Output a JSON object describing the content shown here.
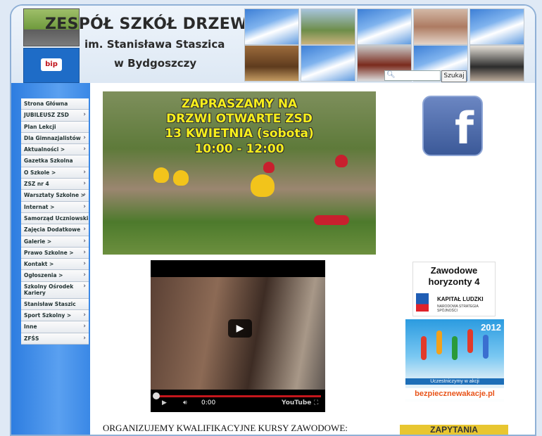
{
  "header": {
    "title_line1": "ZESPÓŁ SZKÓŁ DRZEWNYCH",
    "title_line2": "im. Stanisława Staszica",
    "title_line3": "w Bydgoszczy",
    "bip_label": "bip"
  },
  "search": {
    "placeholder": "",
    "button_label": "Szukaj"
  },
  "sidebar": {
    "items": [
      {
        "label": "Strona Główna",
        "arrow": ""
      },
      {
        "label": "JUBILEUSZ ZSD",
        "arrow": "›"
      },
      {
        "label": "Plan Lekcji",
        "arrow": ""
      },
      {
        "label": "Dla Gimnazjalistów",
        "arrow": "›"
      },
      {
        "label": "Aktualności >",
        "arrow": "›"
      },
      {
        "label": "Gazetka Szkolna",
        "arrow": ""
      },
      {
        "label": "O Szkole >",
        "arrow": "›"
      },
      {
        "label": "ZSZ nr 4",
        "arrow": "›"
      },
      {
        "label": "Warsztaty Szkolne >",
        "arrow": "›"
      },
      {
        "label": "Internat >",
        "arrow": "›"
      },
      {
        "label": "Samorząd Uczniowski",
        "arrow": ""
      },
      {
        "label": "Zajęcia Dodatkowe",
        "arrow": "›"
      },
      {
        "label": "Galerie >",
        "arrow": "›"
      },
      {
        "label": "Prawo Szkolne >",
        "arrow": "›"
      },
      {
        "label": "Kontakt >",
        "arrow": "›"
      },
      {
        "label": "Ogłoszenia >",
        "arrow": "›"
      },
      {
        "label": "Szkolny Ośrodek Kariery",
        "arrow": "›"
      },
      {
        "label": "Stanisław Staszic",
        "arrow": ""
      },
      {
        "label": "Sport Szkolny >",
        "arrow": "›"
      },
      {
        "label": "Inne",
        "arrow": "›"
      },
      {
        "label": "ZFŚS",
        "arrow": "›"
      }
    ]
  },
  "banner": {
    "line1": "ZAPRASZAMY NA",
    "line2": "DRZWI OTWARTE ZSD",
    "line3": "13 KWIETNIA (sobota)",
    "line4": "10:00 - 12:00"
  },
  "facebook": {
    "glyph": "f"
  },
  "video": {
    "time": "0:00",
    "brand": "YouTube"
  },
  "ads": {
    "zh_line1": "Zawodowe",
    "zh_line2": "horyzonty 4",
    "kl_title": "KAPITAŁ LUDZKI",
    "kl_sub": "NARODOWA STRATEGIA SPÓJNOŚCI",
    "bw_year": "2012",
    "bw_participate": "Uczestniczymy w akcji",
    "bw_site": "bezpiecznewakacje.pl"
  },
  "footer_text": "ORGANIZUJEMY KWALIFIKACYJNE KURSY ZAWODOWE:",
  "zap_text": "ZAPYTANIA",
  "colors": {
    "sidebar": "#3a88e6",
    "banner_text": "#f6ef1c",
    "facebook": "#3b5998"
  }
}
